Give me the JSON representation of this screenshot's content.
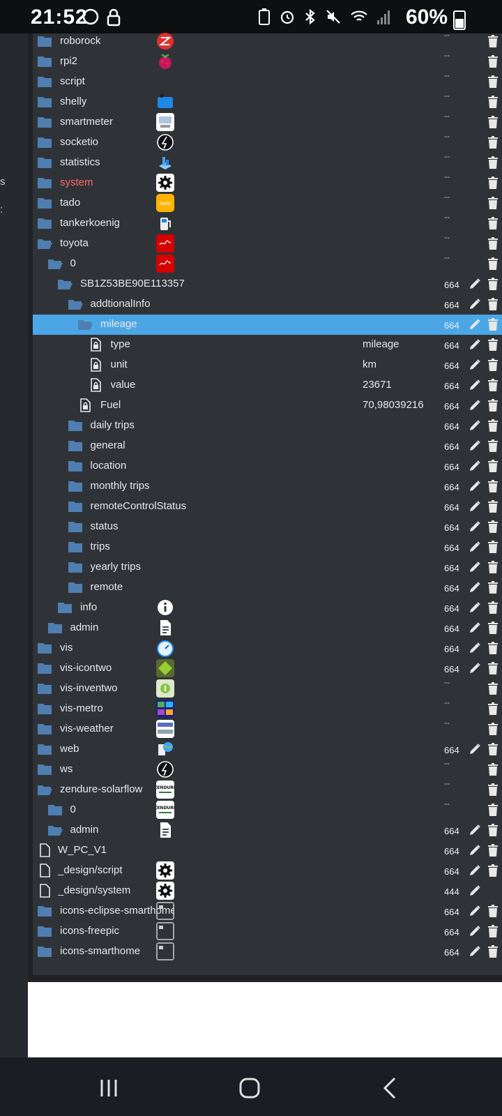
{
  "status_bar": {
    "time": "21:52",
    "battery_text": "60%"
  },
  "sidebar": {
    "fragments": [
      "s",
      ":"
    ]
  },
  "tree": {
    "rows": [
      {
        "name": "roborock",
        "indent": 0,
        "kind": "folder",
        "icon": "roborock-icon",
        "acl": "",
        "dash": "--"
      },
      {
        "name": "rpi2",
        "indent": 0,
        "kind": "folder",
        "icon": "raspberry-icon",
        "acl": "",
        "dash": "--"
      },
      {
        "name": "script",
        "indent": 0,
        "kind": "folder",
        "icon": "",
        "acl": "",
        "dash": "--"
      },
      {
        "name": "shelly",
        "indent": 0,
        "kind": "folder",
        "icon": "shelly-icon",
        "acl": "",
        "dash": "--"
      },
      {
        "name": "smartmeter",
        "indent": 0,
        "kind": "folder",
        "icon": "smartmeter-icon",
        "acl": "",
        "dash": "--"
      },
      {
        "name": "socketio",
        "indent": 0,
        "kind": "folder",
        "icon": "bolt-circle-icon",
        "acl": "",
        "dash": "--"
      },
      {
        "name": "statistics",
        "indent": 0,
        "kind": "folder",
        "icon": "statistics-icon",
        "acl": "",
        "dash": "--"
      },
      {
        "name": "system",
        "indent": 0,
        "kind": "folder",
        "icon": "gear-icon",
        "acl": "",
        "dash": "--",
        "highlight": true
      },
      {
        "name": "tado",
        "indent": 0,
        "kind": "folder",
        "icon": "tado-icon",
        "acl": "",
        "dash": "--"
      },
      {
        "name": "tankerkoenig",
        "indent": 0,
        "kind": "folder",
        "icon": "fuel-pump-icon",
        "acl": "",
        "dash": "--"
      },
      {
        "name": "toyota",
        "indent": 0,
        "kind": "folder-open",
        "icon": "toyota-icon",
        "acl": "",
        "dash": "--"
      },
      {
        "name": "0",
        "indent": 1,
        "kind": "folder-open",
        "icon": "toyota-icon",
        "acl": "",
        "dash": "--"
      },
      {
        "name": "SB1Z53BE90E113357",
        "indent": 2,
        "kind": "folder-open",
        "icon": "",
        "acl": "664",
        "edit": true
      },
      {
        "name": "addtionalInfo",
        "indent": 3,
        "kind": "folder-open",
        "icon": "",
        "acl": "664",
        "edit": true
      },
      {
        "name": "mileage",
        "indent": 4,
        "kind": "folder-open",
        "icon": "",
        "acl": "664",
        "edit": true,
        "selected": true
      },
      {
        "name": "type",
        "indent": 5,
        "kind": "state",
        "icon": "",
        "value": "mileage",
        "acl": "664",
        "edit": true
      },
      {
        "name": "unit",
        "indent": 5,
        "kind": "state",
        "icon": "",
        "value": "km",
        "acl": "664",
        "edit": true
      },
      {
        "name": "value",
        "indent": 5,
        "kind": "state",
        "icon": "",
        "value": "23671",
        "acl": "664",
        "edit": true
      },
      {
        "name": "Fuel",
        "indent": 4,
        "kind": "state",
        "icon": "",
        "value": "70,98039216",
        "acl": "664",
        "edit": true
      },
      {
        "name": "daily trips",
        "indent": 3,
        "kind": "folder",
        "icon": "",
        "acl": "664",
        "edit": true
      },
      {
        "name": "general",
        "indent": 3,
        "kind": "folder",
        "icon": "",
        "acl": "664",
        "edit": true
      },
      {
        "name": "location",
        "indent": 3,
        "kind": "folder",
        "icon": "",
        "acl": "664",
        "edit": true
      },
      {
        "name": "monthly trips",
        "indent": 3,
        "kind": "folder",
        "icon": "",
        "acl": "664",
        "edit": true
      },
      {
        "name": "remoteControlStatus",
        "indent": 3,
        "kind": "folder",
        "icon": "",
        "acl": "664",
        "edit": true
      },
      {
        "name": "status",
        "indent": 3,
        "kind": "folder",
        "icon": "",
        "acl": "664",
        "edit": true
      },
      {
        "name": "trips",
        "indent": 3,
        "kind": "folder",
        "icon": "",
        "acl": "664",
        "edit": true
      },
      {
        "name": "yearly trips",
        "indent": 3,
        "kind": "folder",
        "icon": "",
        "acl": "664",
        "edit": true
      },
      {
        "name": "remote",
        "indent": 3,
        "kind": "folder",
        "icon": "",
        "acl": "664",
        "edit": true
      },
      {
        "name": "info",
        "indent": 2,
        "kind": "folder",
        "icon": "info-icon",
        "acl": "664",
        "edit": true
      },
      {
        "name": "admin",
        "indent": 1,
        "kind": "folder",
        "icon": "document-icon",
        "acl": "664",
        "edit": true
      },
      {
        "name": "vis",
        "indent": 0,
        "kind": "folder",
        "icon": "gauge-icon",
        "acl": "664",
        "edit": true
      },
      {
        "name": "vis-icontwo",
        "indent": 0,
        "kind": "folder",
        "icon": "vis-icontwo-icon",
        "acl": "664",
        "edit": true
      },
      {
        "name": "vis-inventwo",
        "indent": 0,
        "kind": "folder",
        "icon": "vis-inventwo-icon",
        "acl": "",
        "dash": "--"
      },
      {
        "name": "vis-metro",
        "indent": 0,
        "kind": "folder",
        "icon": "vis-metro-icon",
        "acl": "",
        "dash": "--"
      },
      {
        "name": "vis-weather",
        "indent": 0,
        "kind": "folder",
        "icon": "vis-weather-icon",
        "acl": "",
        "dash": "--"
      },
      {
        "name": "web",
        "indent": 0,
        "kind": "folder",
        "icon": "web-globe-icon",
        "acl": "664",
        "edit": true
      },
      {
        "name": "ws",
        "indent": 0,
        "kind": "folder",
        "icon": "bolt-circle-icon",
        "acl": "",
        "dash": "--"
      },
      {
        "name": "zendure-solarflow",
        "indent": 0,
        "kind": "folder-open",
        "icon": "zendure-icon",
        "acl": "",
        "dash": "--"
      },
      {
        "name": "0",
        "indent": 1,
        "kind": "folder",
        "icon": "zendure-icon",
        "acl": "",
        "dash": "--"
      },
      {
        "name": "admin",
        "indent": 1,
        "kind": "folder-open",
        "icon": "document-icon",
        "acl": "664",
        "edit": true
      },
      {
        "name": "W_PC_V1",
        "indent": 0,
        "kind": "file",
        "icon": "",
        "acl": "664",
        "edit": true
      },
      {
        "name": "_design/script",
        "indent": 0,
        "kind": "file",
        "icon": "gear-icon",
        "acl": "664",
        "edit": true
      },
      {
        "name": "_design/system",
        "indent": 0,
        "kind": "file",
        "icon": "gear-icon",
        "acl": "444",
        "edit": true,
        "nodelete": true
      },
      {
        "name": "icons-eclipse-smarthome",
        "indent": 0,
        "kind": "folder",
        "icon": "broken-image-icon",
        "acl": "664",
        "edit": true
      },
      {
        "name": "icons-freepic",
        "indent": 0,
        "kind": "folder",
        "icon": "broken-image-icon",
        "acl": "664",
        "edit": true
      },
      {
        "name": "icons-smarthome",
        "indent": 0,
        "kind": "folder",
        "icon": "broken-image-icon",
        "acl": "664",
        "edit": true
      }
    ]
  },
  "colors": {
    "panel": "#2f3338",
    "selected": "#4ca6e5",
    "folder": "#4f7fb0",
    "highlight": "#ff6b6b"
  }
}
